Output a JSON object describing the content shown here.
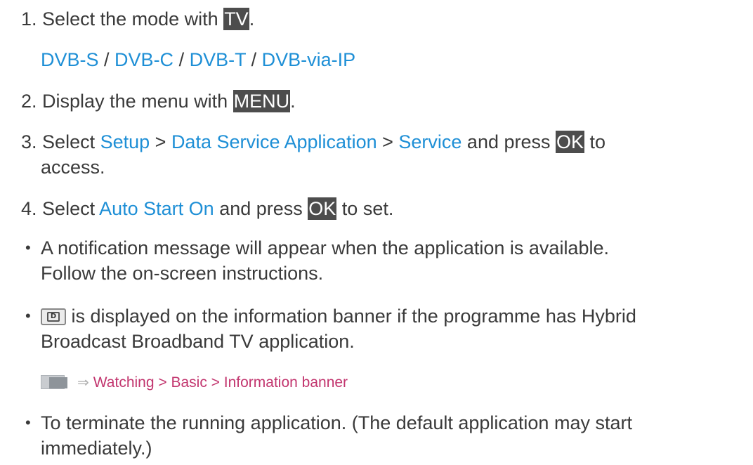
{
  "steps": {
    "s1": {
      "num": "1.",
      "text_before": "Select the mode with ",
      "key": "TV",
      "text_after": "."
    },
    "s1_modes": {
      "m1": "DVB-S",
      "sep1": " / ",
      "m2": "DVB-C",
      "sep2": " / ",
      "m3": "DVB-T",
      "sep3": " / ",
      "m4": "DVB-via-IP"
    },
    "s2": {
      "num": "2.",
      "text_before": "Display the menu with ",
      "key": "MENU",
      "text_after": "."
    },
    "s3": {
      "num": "3.",
      "text_before": "Select ",
      "link1": "Setup",
      "sep1": " > ",
      "link2": "Data Service Application",
      "sep2": " > ",
      "link3": "Service",
      "text_mid": " and press ",
      "key": "OK",
      "text_after": " to",
      "line2": "access."
    },
    "s4": {
      "num": "4.",
      "text_before": "Select ",
      "link": "Auto Start On",
      "text_mid": " and press ",
      "key": "OK",
      "text_after": " to set."
    }
  },
  "bullets": {
    "b1": {
      "dot": "•",
      "line1": "A notification message will appear when the application is available.",
      "line2": "Follow the on-screen instructions."
    },
    "b2": {
      "dot": "•",
      "line1_after_icon": " is displayed on the information banner if the programme has Hybrid",
      "line2": "Broadcast Broadband TV application.",
      "icon_glyph": "D",
      "icon_name": "data-service-d-icon"
    },
    "ref": {
      "arrow": "⇒",
      "link1": "Watching",
      "sep1": " > ",
      "link2": "Basic",
      "sep2": " > ",
      "link3": "Information banner",
      "icon_name": "ereference-icon"
    },
    "b3": {
      "dot": "•",
      "line1": "To terminate the running application. (The default application may start",
      "line2": "immediately.)"
    }
  },
  "colors": {
    "link_blue": "#1e8fd6",
    "link_pink": "#c2356e",
    "key_bg": "#4d4d4d",
    "text": "#3a3a3a"
  }
}
